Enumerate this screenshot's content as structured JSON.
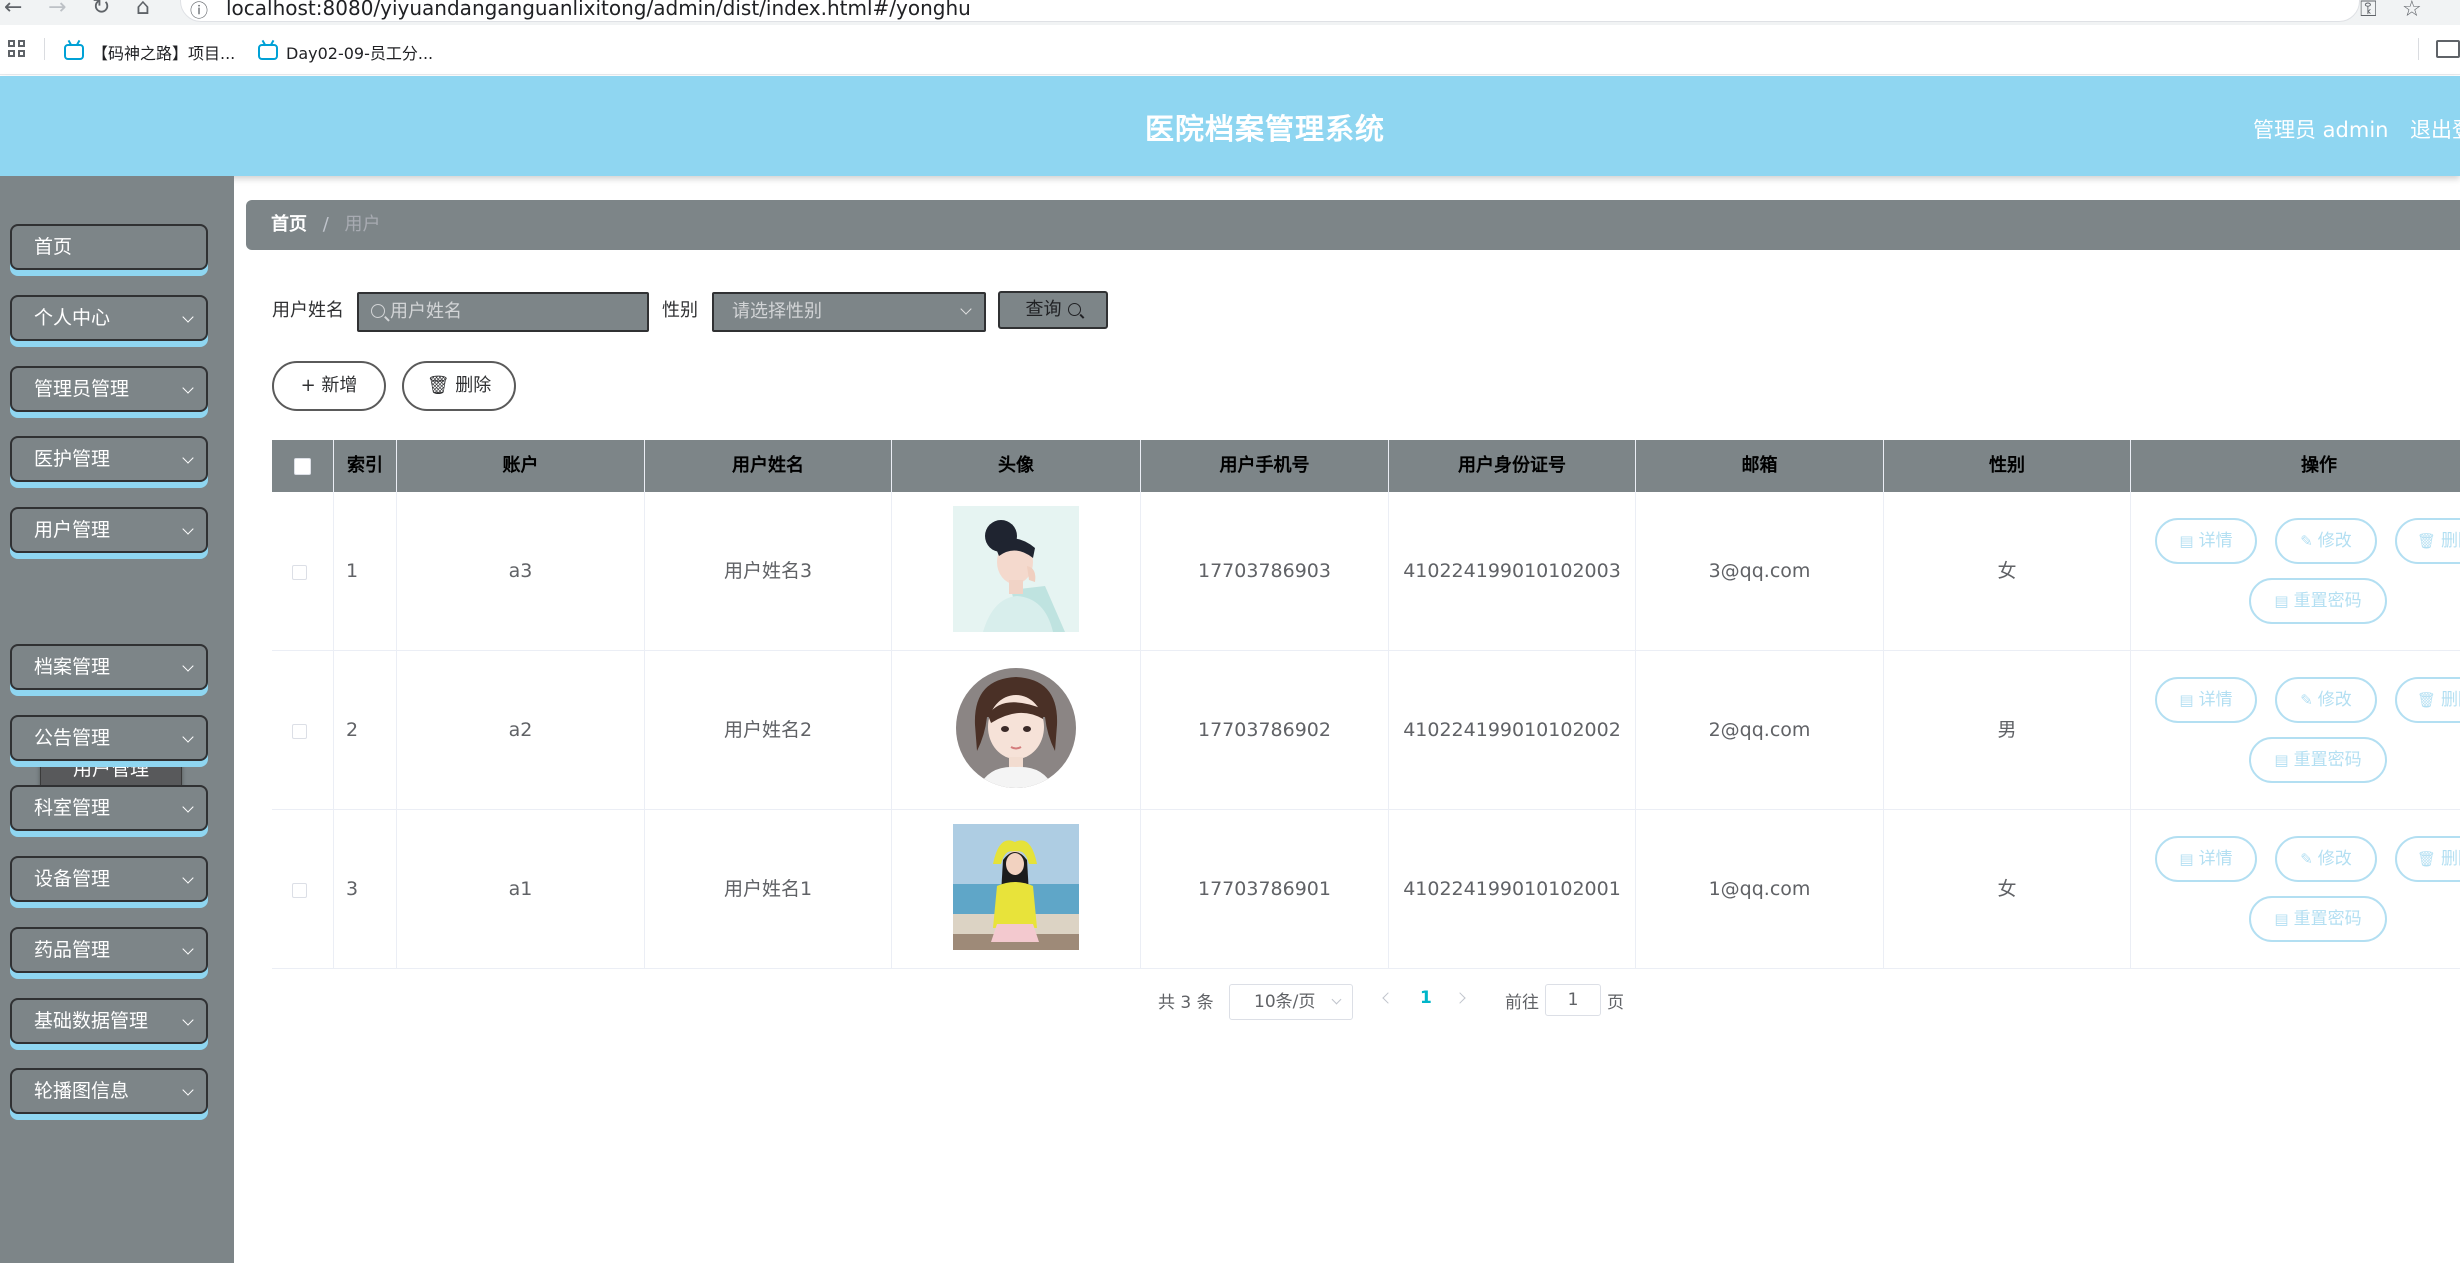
{
  "browser": {
    "url": "localhost:8080/yiyuandanganguanlixitong/admin/dist/index.html#/yonghu",
    "bookmarks": [
      "【码神之路】项目...",
      "Day02-09-员工分..."
    ]
  },
  "header": {
    "title": "医院档案管理系统",
    "user_label": "管理员 admin",
    "logout_label": "退出登"
  },
  "sidebar": {
    "items": [
      {
        "label": "首页",
        "has_arrow": false
      },
      {
        "label": "个人中心",
        "has_arrow": true
      },
      {
        "label": "管理员管理",
        "has_arrow": true
      },
      {
        "label": "医护管理",
        "has_arrow": true
      },
      {
        "label": "用户管理",
        "has_arrow": true
      },
      {
        "label": "档案管理",
        "has_arrow": true
      },
      {
        "label": "公告管理",
        "has_arrow": true
      },
      {
        "label": "科室管理",
        "has_arrow": true
      },
      {
        "label": "设备管理",
        "has_arrow": true
      },
      {
        "label": "药品管理",
        "has_arrow": true
      },
      {
        "label": "基础数据管理",
        "has_arrow": true
      },
      {
        "label": "轮播图信息",
        "has_arrow": true
      }
    ],
    "submenu_label": "用户管理"
  },
  "breadcrumb": {
    "home": "首页",
    "separator": "/",
    "current": "用户"
  },
  "search": {
    "name_label": "用户姓名",
    "name_placeholder": "用户姓名",
    "gender_label": "性别",
    "gender_placeholder": "请选择性别",
    "query_label": "查询"
  },
  "actions": {
    "add_label": "+ 新增",
    "delete_label": "删除"
  },
  "table": {
    "headers": [
      "索引",
      "账户",
      "用户姓名",
      "头像",
      "用户手机号",
      "用户身份证号",
      "邮箱",
      "性别",
      "操作"
    ],
    "rows": [
      {
        "index": "1",
        "account": "a3",
        "name": "用户姓名3",
        "phone": "17703786903",
        "id_card": "410224199010102003",
        "email": "3@qq.com",
        "gender": "女",
        "avatar": "woman-with-hair-bun-avatar"
      },
      {
        "index": "2",
        "account": "a2",
        "name": "用户姓名2",
        "phone": "17703786902",
        "id_card": "410224199010102002",
        "email": "2@qq.com",
        "gender": "男",
        "avatar": "cartoon-girl-bob-avatar"
      },
      {
        "index": "3",
        "account": "a1",
        "name": "用户姓名1",
        "phone": "17703786901",
        "id_card": "410224199010102001",
        "email": "1@qq.com",
        "gender": "女",
        "avatar": "girl-at-beach-avatar"
      }
    ],
    "ops": {
      "detail": "详情",
      "edit": "修改",
      "delete": "删除",
      "reset": "重置密码"
    }
  },
  "pagination": {
    "total_text": "共 3 条",
    "page_size": "10条/页",
    "current_page": "1",
    "goto_label": "前往",
    "goto_value": "1",
    "page_suffix": "页"
  },
  "colors": {
    "header_bg": "#8fd6f1",
    "sidebar_bg": "#7d8588",
    "op_button": "#b3dff2",
    "page_active": "#00b6c9"
  }
}
